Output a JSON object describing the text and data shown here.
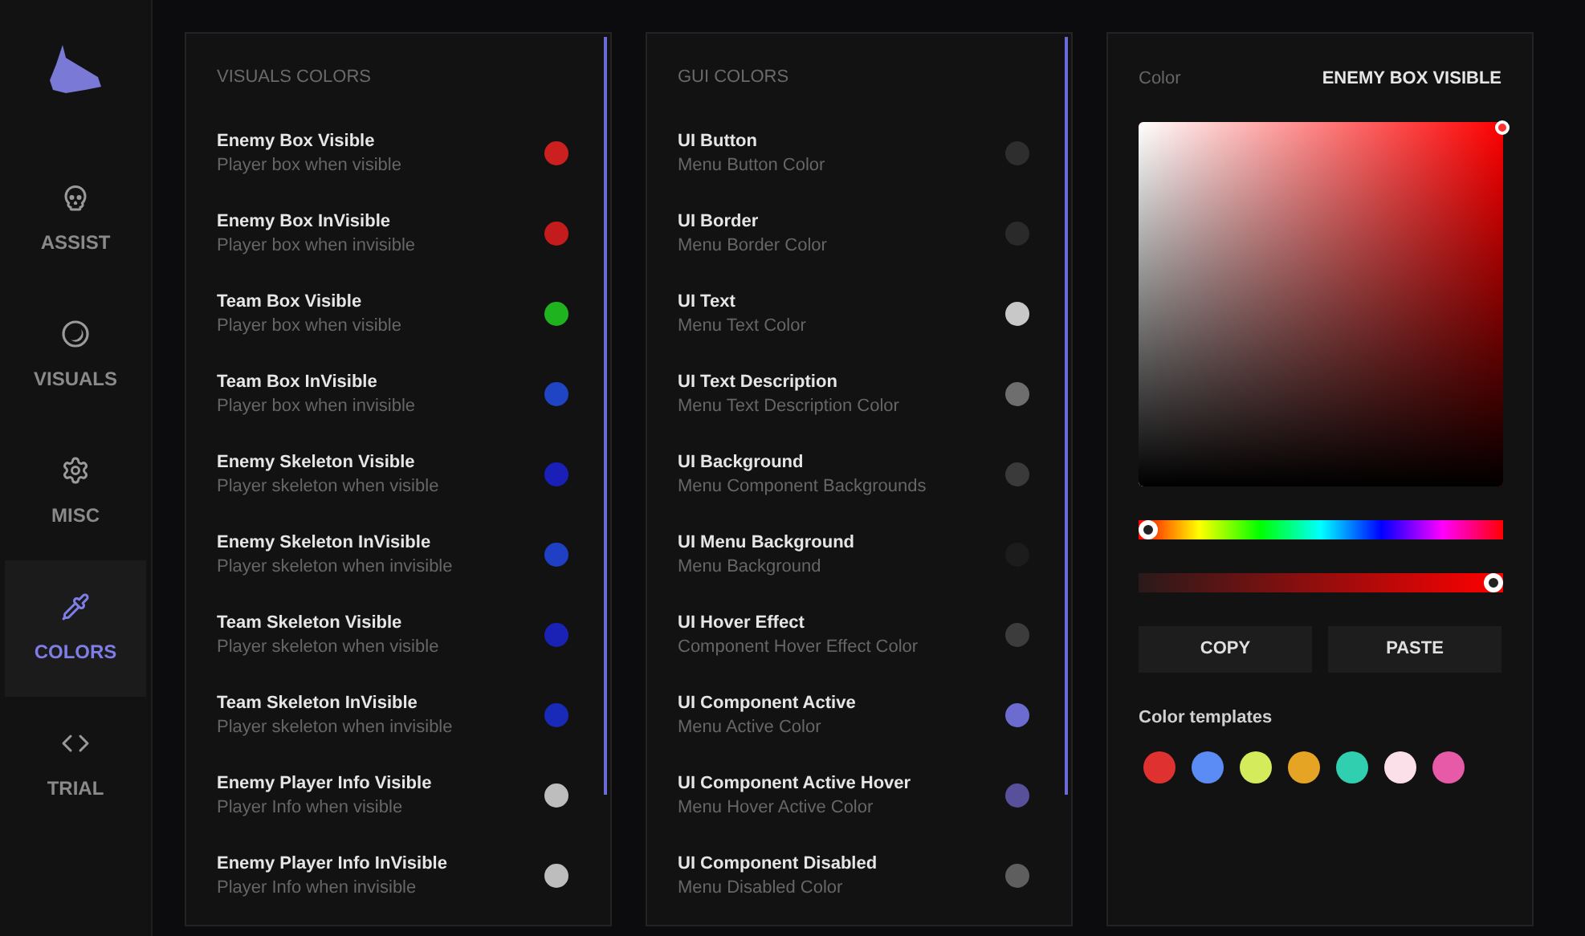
{
  "sidebar": {
    "items": [
      {
        "label": "ASSIST",
        "selected": false
      },
      {
        "label": "VISUALS",
        "selected": false
      },
      {
        "label": "MISC",
        "selected": false
      },
      {
        "label": "COLORS",
        "selected": true
      },
      {
        "label": "TRIAL",
        "selected": false
      }
    ]
  },
  "visuals_colors": {
    "title": "VISUALS COLORS",
    "items": [
      {
        "name": "Enemy Box Visible",
        "description": "Player box when visible",
        "color": "#cc1f1f"
      },
      {
        "name": "Enemy Box InVisible",
        "description": "Player box when invisible",
        "color": "#c41c1c"
      },
      {
        "name": "Team Box Visible",
        "description": "Player box when visible",
        "color": "#1fb31f"
      },
      {
        "name": "Team Box InVisible",
        "description": "Player box when invisible",
        "color": "#1f45c4"
      },
      {
        "name": "Enemy Skeleton Visible",
        "description": "Player skeleton when visible",
        "color": "#1a1fb8"
      },
      {
        "name": "Enemy Skeleton InVisible",
        "description": "Player skeleton when invisible",
        "color": "#1f3fc4"
      },
      {
        "name": "Team Skeleton Visible",
        "description": "Player skeleton when visible",
        "color": "#1a22b5"
      },
      {
        "name": "Team Skeleton InVisible",
        "description": "Player skeleton when invisible",
        "color": "#1a2ab8"
      },
      {
        "name": "Enemy Player Info Visible",
        "description": "Player Info when visible",
        "color": "#bdbdbd"
      },
      {
        "name": "Enemy Player Info InVisible",
        "description": "Player Info when invisible",
        "color": "#bdbdbd"
      }
    ]
  },
  "gui_colors": {
    "title": "GUI COLORS",
    "items": [
      {
        "name": "UI Button",
        "description": "Menu Button Color",
        "color": "#2e2e2e"
      },
      {
        "name": "UI Border",
        "description": "Menu Border Color",
        "color": "#2a2a2a"
      },
      {
        "name": "UI Text",
        "description": "Menu Text Color",
        "color": "#c8c8c8"
      },
      {
        "name": "UI Text Description",
        "description": "Menu Text Description Color",
        "color": "#6e6e6e"
      },
      {
        "name": "UI Background",
        "description": "Menu Component Backgrounds",
        "color": "#3a3a3a"
      },
      {
        "name": "UI Menu Background",
        "description": "Menu Background",
        "color": "#1c1c1c"
      },
      {
        "name": "UI Hover Effect",
        "description": "Component Hover Effect Color",
        "color": "#3c3c3c"
      },
      {
        "name": "UI Component Active",
        "description": "Menu Active Color",
        "color": "#6c6cd0"
      },
      {
        "name": "UI Component Active Hover",
        "description": "Menu Hover Active Color",
        "color": "#58509a"
      },
      {
        "name": "UI Component Disabled",
        "description": "Menu Disabled Color",
        "color": "#5e5e5e"
      }
    ]
  },
  "color_picker": {
    "label": "Color",
    "target": "ENEMY BOX VISIBLE",
    "hue": {
      "level": 0
    },
    "alpha": {
      "level": 1
    },
    "buttons": [
      "COPY",
      "PASTE"
    ],
    "templates_label": "Color templates",
    "templates": [
      {
        "color": "#e03131"
      },
      {
        "color": "#5b8cf5"
      },
      {
        "color": "#d4ec5c"
      },
      {
        "color": "#e5a423"
      },
      {
        "color": "#2fcfb0"
      },
      {
        "color": "#fbe0ea"
      },
      {
        "color": "#e65aa8"
      }
    ]
  }
}
